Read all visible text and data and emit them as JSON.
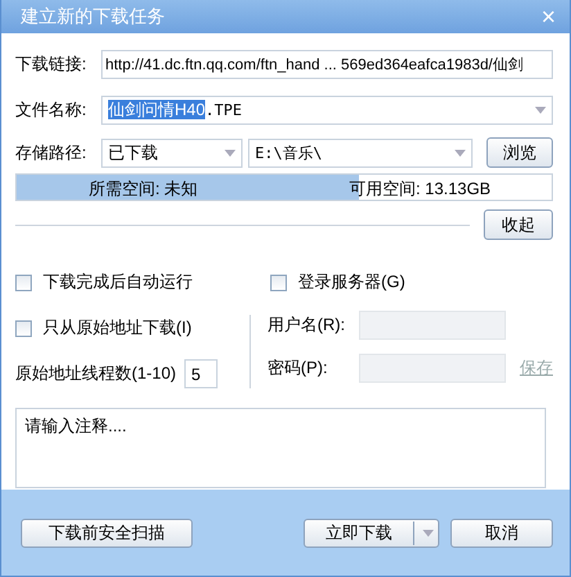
{
  "window": {
    "title": "建立新的下载任务",
    "close": "×"
  },
  "link": {
    "label": "下载链接:",
    "value": "http://41.dc.ftn.qq.com/ftn_hand ... 569ed364eafca1983d/仙剑"
  },
  "file_name": {
    "label": "文件名称:",
    "value_selected": "仙剑问情H40",
    "value_rest": ".TPE"
  },
  "save_path": {
    "label": "存储路径:",
    "category": "已下载",
    "folder": "E:\\音乐\\",
    "browse": "浏览"
  },
  "space": {
    "level": 0.64,
    "needed": "所需空间: 未知",
    "available": "可用空间: 13.13GB"
  },
  "collapse": "收起",
  "options": [
    {
      "label": "下载完成后自动运行",
      "checked": false
    },
    {
      "label": "只从原始地址下载(I)",
      "checked": false
    }
  ],
  "threads": {
    "label": "原始地址线程数(1-10)",
    "value": "5"
  },
  "server": {
    "label": "登录服务器(G)",
    "checked": false,
    "username": {
      "label": "用户名(R):",
      "disabled": true
    },
    "password": {
      "label": "密码(P):",
      "disabled": true
    },
    "save": {
      "label": "保存",
      "disabled": true
    }
  },
  "comment": {
    "placeholder": "请输入注释...."
  },
  "buttons": {
    "scan": "下载前安全扫描",
    "download": "立即下载",
    "cancel": "取消"
  }
}
